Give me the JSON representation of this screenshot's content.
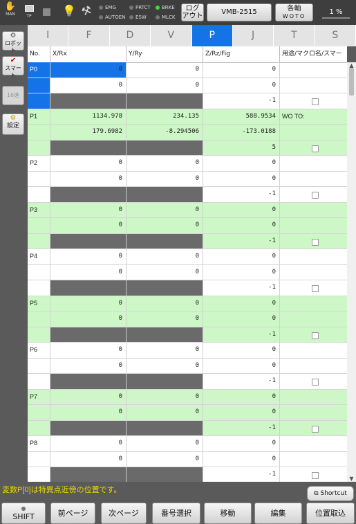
{
  "topbar": {
    "man_label": "MAN",
    "tp_label": "TP",
    "indicators": [
      {
        "label": "EMG",
        "on": false
      },
      {
        "label": "AUTOEN",
        "on": false
      },
      {
        "label": "PRTCT",
        "on": false
      },
      {
        "label": "ESW",
        "on": false
      },
      {
        "label": "BRKE",
        "on": true
      },
      {
        "label": "MLCK",
        "on": false
      }
    ],
    "logout_label": "ログ\nアウト",
    "robot_name": "VMB-2515",
    "axis_label_top": "各軸",
    "axis_label_bottom": "WOTO",
    "speed": "1 %"
  },
  "sidebar": {
    "robot_label": "ロボット",
    "smart_label": "スマート",
    "hex_label": "16進",
    "settings_label": "設定"
  },
  "tabs": [
    "I",
    "F",
    "D",
    "V",
    "P",
    "J",
    "T",
    "S"
  ],
  "active_tab": "P",
  "table": {
    "headers": {
      "no": "No.",
      "x": "X/Rx",
      "y": "Y/Ry",
      "z": "Z/Rz/Fig",
      "use": "用途/マクロ名/スマー"
    },
    "points": [
      {
        "label": "P0",
        "rows": [
          [
            "0",
            "0",
            "0",
            ""
          ],
          [
            "0",
            "0",
            "0",
            ""
          ],
          [
            "",
            "",
            "-1",
            ""
          ]
        ]
      },
      {
        "label": "P1",
        "rows": [
          [
            "1134.978",
            "234.135",
            "588.9534",
            "WO TO:"
          ],
          [
            "179.6982",
            "-8.294506",
            "-173.0188",
            ""
          ],
          [
            "",
            "",
            "5",
            ""
          ]
        ]
      },
      {
        "label": "P2",
        "rows": [
          [
            "0",
            "0",
            "0",
            ""
          ],
          [
            "0",
            "0",
            "0",
            ""
          ],
          [
            "",
            "",
            "-1",
            ""
          ]
        ]
      },
      {
        "label": "P3",
        "rows": [
          [
            "0",
            "0",
            "0",
            ""
          ],
          [
            "0",
            "0",
            "0",
            ""
          ],
          [
            "",
            "",
            "-1",
            ""
          ]
        ]
      },
      {
        "label": "P4",
        "rows": [
          [
            "0",
            "0",
            "0",
            ""
          ],
          [
            "0",
            "0",
            "0",
            ""
          ],
          [
            "",
            "",
            "-1",
            ""
          ]
        ]
      },
      {
        "label": "P5",
        "rows": [
          [
            "0",
            "0",
            "0",
            ""
          ],
          [
            "0",
            "0",
            "0",
            ""
          ],
          [
            "",
            "",
            "-1",
            ""
          ]
        ]
      },
      {
        "label": "P6",
        "rows": [
          [
            "0",
            "0",
            "0",
            ""
          ],
          [
            "0",
            "0",
            "0",
            ""
          ],
          [
            "",
            "",
            "-1",
            ""
          ]
        ]
      },
      {
        "label": "P7",
        "rows": [
          [
            "0",
            "0",
            "0",
            ""
          ],
          [
            "0",
            "0",
            "0",
            ""
          ],
          [
            "",
            "",
            "-1",
            ""
          ]
        ]
      },
      {
        "label": "P8",
        "rows": [
          [
            "0",
            "0",
            "0",
            ""
          ],
          [
            "0",
            "0",
            "0",
            ""
          ],
          [
            "",
            "",
            "-1",
            ""
          ]
        ]
      }
    ]
  },
  "status_message": "変数P[0]は特異点近傍の位置です。",
  "shortcut_label": "Shortcut",
  "bottom_buttons": {
    "shift": "SHIFT",
    "prev_page": "前ページ",
    "next_page": "次ページ",
    "number_select": "番号選択",
    "move": "移動",
    "edit": "編集",
    "take_position": "位置取込"
  },
  "colors": {
    "accent": "#1473e6",
    "green_row": "#cdf7c6",
    "dark_cell": "#6a6a6a",
    "status_text": "#e8d900"
  }
}
